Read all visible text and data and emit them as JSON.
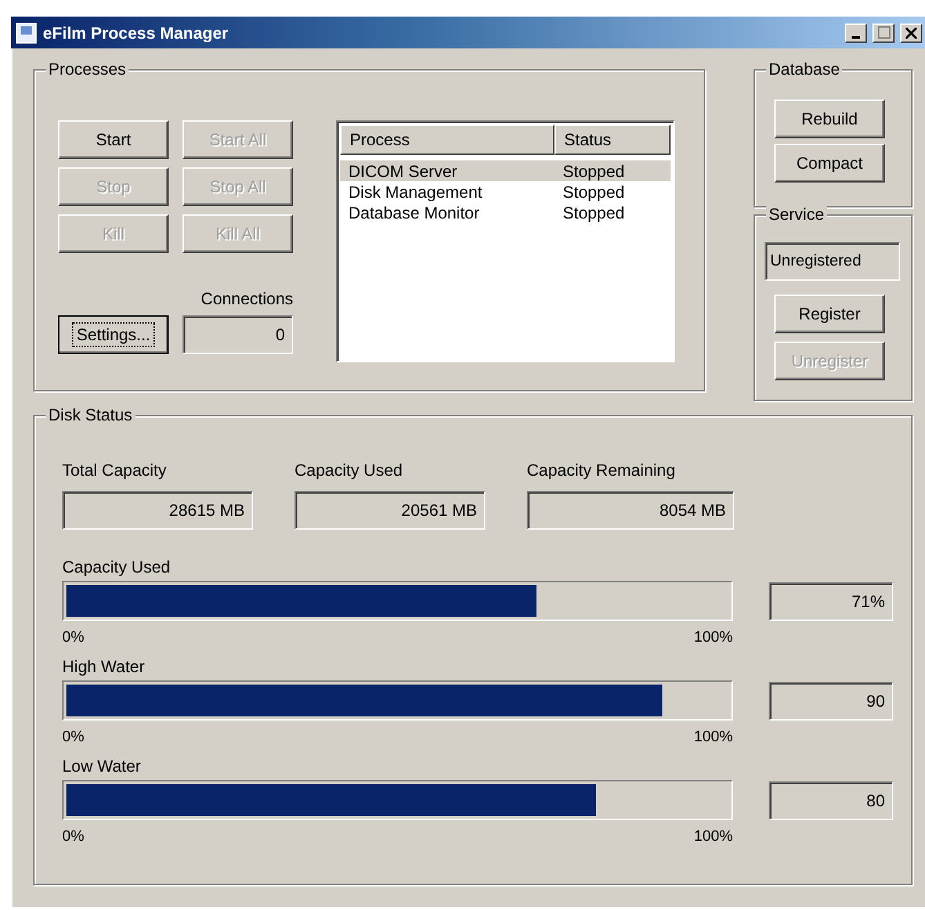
{
  "window": {
    "title": "eFilm Process Manager"
  },
  "processes": {
    "title": "Processes",
    "buttons": [
      {
        "label": "Start",
        "disabled": false
      },
      {
        "label": "Start All",
        "disabled": true
      },
      {
        "label": "Stop",
        "disabled": true
      },
      {
        "label": "Stop All",
        "disabled": true
      },
      {
        "label": "Kill",
        "disabled": true
      },
      {
        "label": "Kill All",
        "disabled": true
      }
    ],
    "settings_button": {
      "label": "Settings...",
      "focused": true
    },
    "connections": {
      "label": "Connections",
      "value": "0"
    },
    "list": {
      "columns": [
        "Process",
        "Status"
      ],
      "rows": [
        {
          "process": "DICOM Server",
          "status": "Stopped",
          "selected": true
        },
        {
          "process": "Disk Management",
          "status": "Stopped",
          "selected": false
        },
        {
          "process": "Database Monitor",
          "status": "Stopped",
          "selected": false
        }
      ]
    }
  },
  "database": {
    "title": "Database",
    "buttons": [
      {
        "label": "Rebuild",
        "disabled": false
      },
      {
        "label": "Compact",
        "disabled": false
      }
    ]
  },
  "service": {
    "title": "Service",
    "status": "Unregistered",
    "buttons": [
      {
        "label": "Register",
        "disabled": false
      },
      {
        "label": "Unregister",
        "disabled": true
      }
    ]
  },
  "disk_status": {
    "title": "Disk Status",
    "fields": [
      {
        "label": "Total Capacity",
        "value": "28615 MB"
      },
      {
        "label": "Capacity Used",
        "value": "20561 MB"
      },
      {
        "label": "Capacity Remaining",
        "value": "8054 MB"
      }
    ],
    "meters": [
      {
        "label": "Capacity Used",
        "level": 0.71,
        "min_label": "0%",
        "max_label": "100%",
        "reading": "71%"
      },
      {
        "label": "High Water",
        "level": 0.9,
        "min_label": "0%",
        "max_label": "100%",
        "reading": "90"
      },
      {
        "label": "Low Water",
        "level": 0.8,
        "min_label": "0%",
        "max_label": "100%",
        "reading": "80"
      }
    ]
  }
}
